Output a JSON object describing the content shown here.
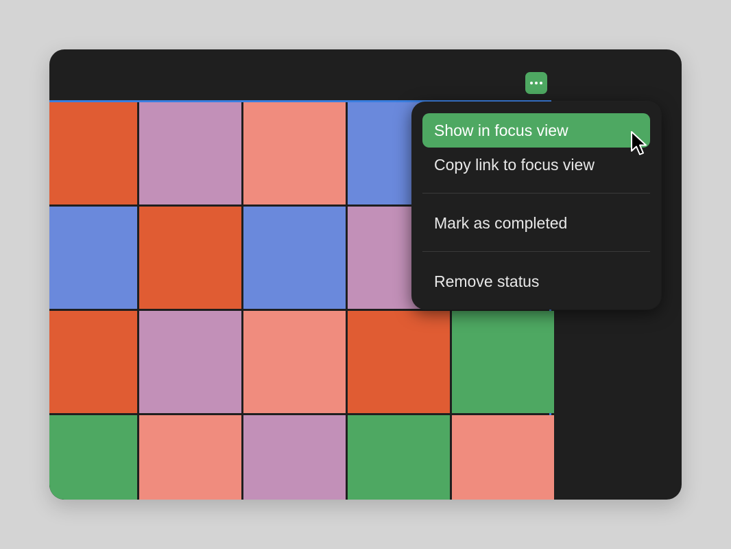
{
  "colors": {
    "page_background": "#d4d4d4",
    "window_background": "#1f1f1f",
    "accent_green": "#4ea862",
    "selection_blue": "#3a7ee0",
    "orange": "#e05c33",
    "mauve": "#c290b8",
    "salmon": "#f08c7e",
    "blue": "#6a89dc",
    "green": "#4ea862"
  },
  "toolbar": {
    "more_button_icon": "ellipsis-icon"
  },
  "grid": {
    "rows": [
      [
        "orange",
        "mauve",
        "salmon",
        "blue",
        "green"
      ],
      [
        "blue",
        "orange",
        "blue",
        "mauve",
        "green"
      ],
      [
        "orange",
        "mauve",
        "salmon",
        "orange",
        "green"
      ],
      [
        "green",
        "salmon",
        "mauve",
        "green",
        "salmon"
      ]
    ]
  },
  "context_menu": {
    "show_in_focus_view": "Show in focus view",
    "copy_link_to_focus_view": "Copy link to focus view",
    "mark_as_completed": "Mark as completed",
    "remove_status": "Remove status"
  },
  "cursor": {
    "icon": "pointer-cursor-icon"
  }
}
